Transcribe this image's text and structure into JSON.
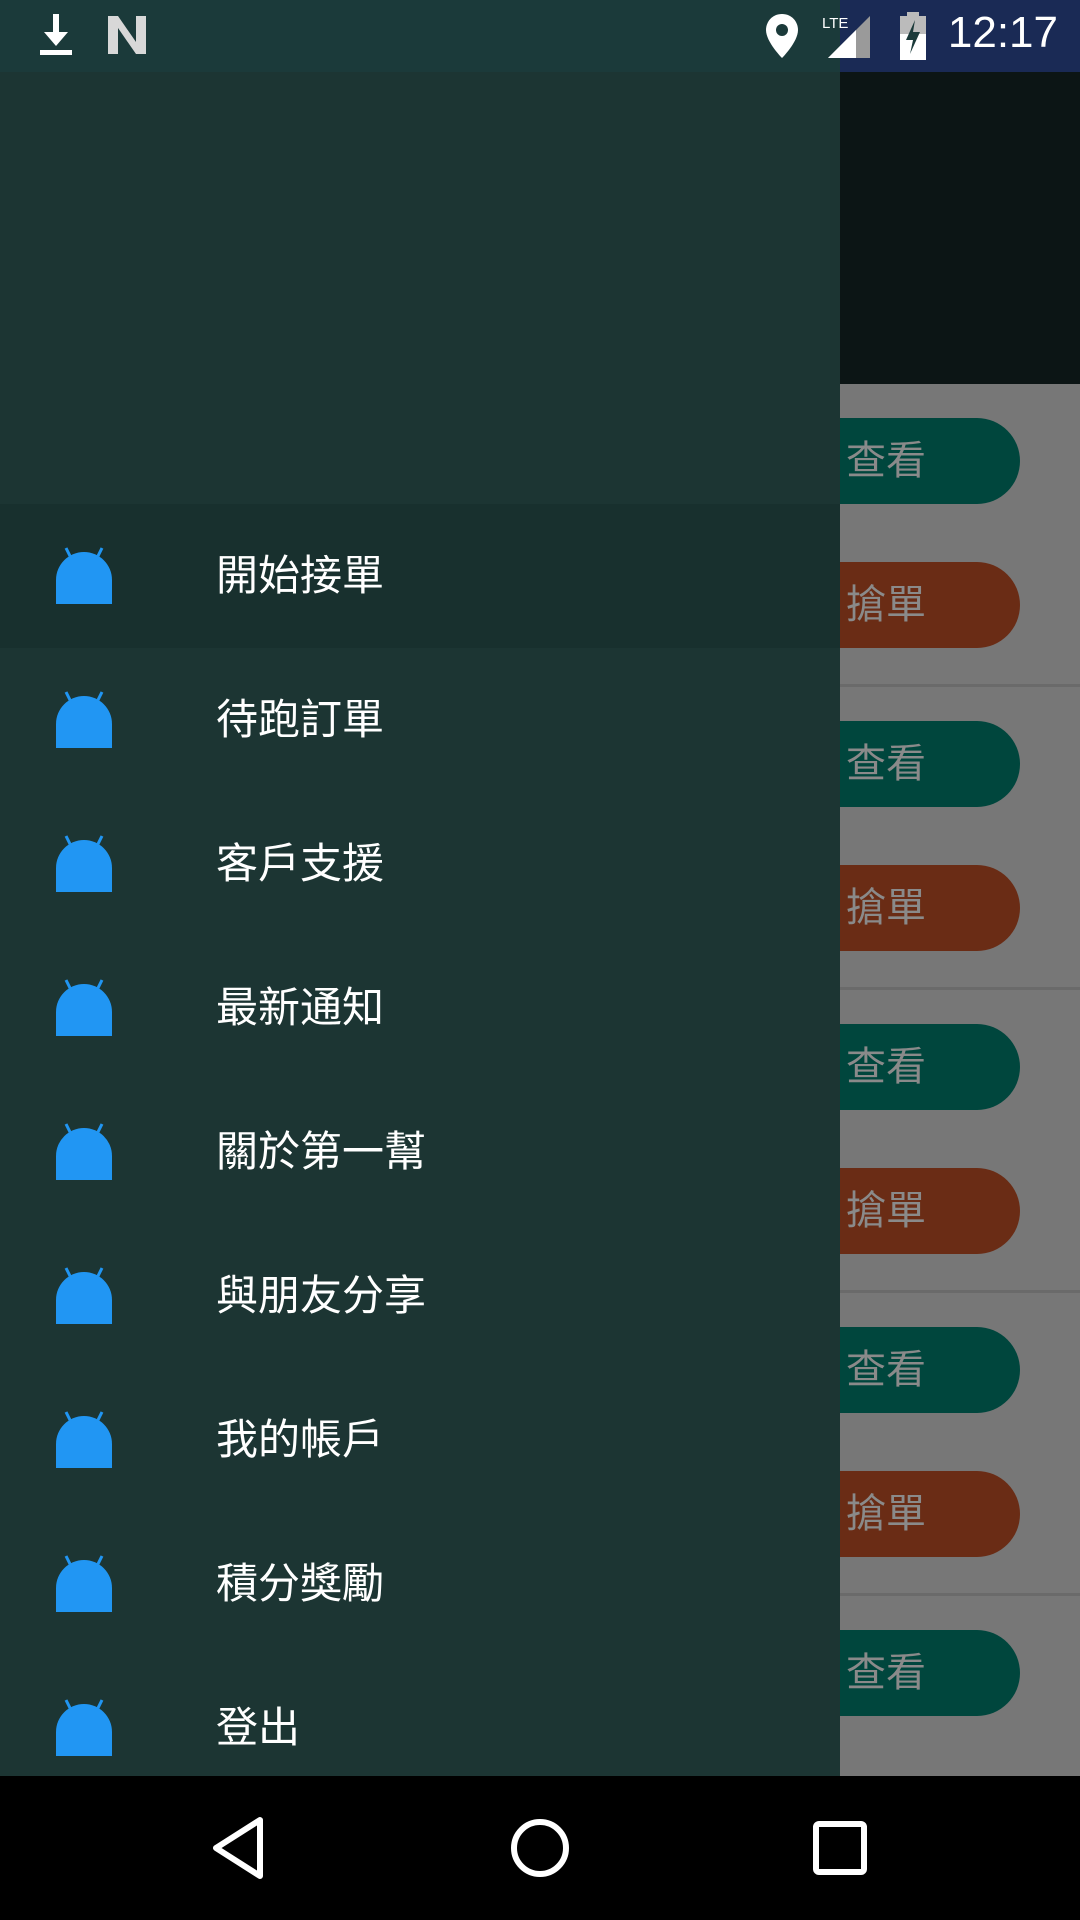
{
  "status_bar": {
    "time": "12:17",
    "left_icons": [
      "download-icon",
      "n-logo-icon"
    ],
    "right_icons": [
      "location-icon",
      "lte-signal-icon",
      "battery-charging-icon"
    ],
    "network": "LTE"
  },
  "background_list": {
    "rows": [
      {
        "view_label": "查看",
        "grab_label": "搶單"
      },
      {
        "view_label": "查看",
        "grab_label": "搶單"
      },
      {
        "view_label": "查看",
        "grab_label": "搶單"
      },
      {
        "view_label": "查看",
        "grab_label": "搶單"
      },
      {
        "view_label": "查看",
        "grab_label": ""
      }
    ],
    "colors": {
      "view": "#00463d",
      "grab": "#6a2c15"
    }
  },
  "drawer": {
    "items": [
      {
        "label": "開始接單",
        "icon": "android-icon",
        "selected": true
      },
      {
        "label": "待跑訂單",
        "icon": "android-icon"
      },
      {
        "label": "客戶支援",
        "icon": "android-icon"
      },
      {
        "label": "最新通知",
        "icon": "android-icon"
      },
      {
        "label": "關於第一幫",
        "icon": "android-icon"
      },
      {
        "label": "與朋友分享",
        "icon": "android-icon"
      },
      {
        "label": "我的帳戶",
        "icon": "android-icon"
      },
      {
        "label": "積分獎勵",
        "icon": "android-icon"
      },
      {
        "label": "登出",
        "icon": "android-icon"
      }
    ],
    "colors": {
      "background": "#1c3533",
      "icon": "#2196f3"
    }
  },
  "nav_bar": {
    "buttons": [
      "back-icon",
      "home-icon",
      "recents-icon"
    ]
  }
}
